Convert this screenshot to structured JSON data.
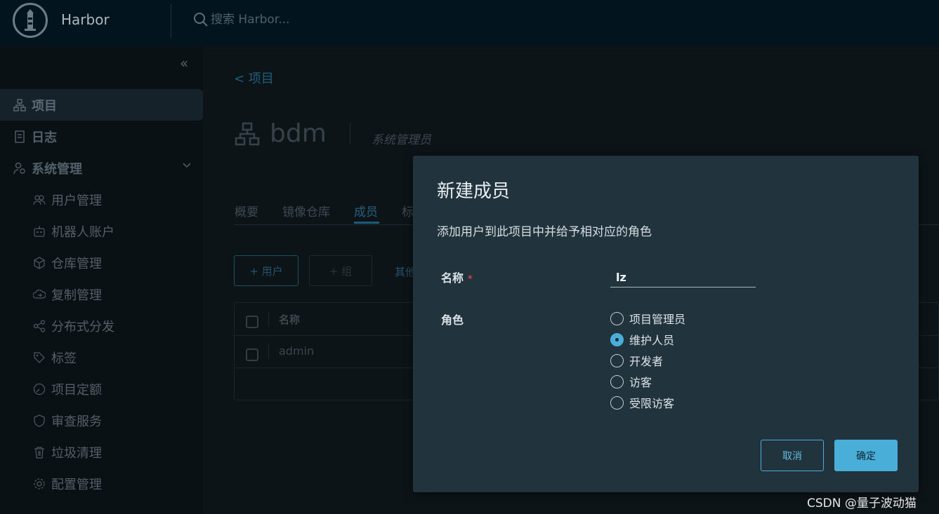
{
  "header": {
    "brand": "Harbor",
    "search_placeholder": "搜索 Harbor..."
  },
  "sidebar": {
    "collapse_glyph": "«",
    "items": [
      {
        "label": "项目",
        "icon": "project-icon",
        "active": true
      },
      {
        "label": "日志",
        "icon": "log-icon"
      },
      {
        "label": "系统管理",
        "icon": "admin-icon",
        "expanded": true
      },
      {
        "label": "用户管理",
        "icon": "users-icon"
      },
      {
        "label": "机器人账户",
        "icon": "robot-icon"
      },
      {
        "label": "仓库管理",
        "icon": "registry-icon"
      },
      {
        "label": "复制管理",
        "icon": "replication-icon"
      },
      {
        "label": "分布式分发",
        "icon": "distribution-icon"
      },
      {
        "label": "标签",
        "icon": "tag-icon"
      },
      {
        "label": "项目定额",
        "icon": "quota-icon"
      },
      {
        "label": "审查服务",
        "icon": "shield-icon"
      },
      {
        "label": "垃圾清理",
        "icon": "trash-icon"
      },
      {
        "label": "配置管理",
        "icon": "gear-icon"
      }
    ]
  },
  "main": {
    "back_label": "< 项目",
    "project_name": "bdm",
    "project_role": "系统管理员",
    "tabs": [
      "概要",
      "镜像仓库",
      "成员",
      "标"
    ],
    "active_tab": "成员",
    "add_user_label": "+ 用户",
    "add_group_label": "+ 组",
    "others_label": "其他",
    "table": {
      "header": "名称",
      "rows": [
        "admin"
      ]
    }
  },
  "dialog": {
    "title": "新建成员",
    "description": "添加用户到此项目中并给予相对应的角色",
    "name_label": "名称",
    "required_mark": "*",
    "name_value": "lz",
    "role_label": "角色",
    "roles": [
      "项目管理员",
      "维护人员",
      "开发者",
      "访客",
      "受限访客"
    ],
    "selected_role": "维护人员",
    "cancel_label": "取消",
    "ok_label": "确定",
    "accent_color": "#49afd9"
  },
  "watermark": "CSDN @量子波动猫"
}
